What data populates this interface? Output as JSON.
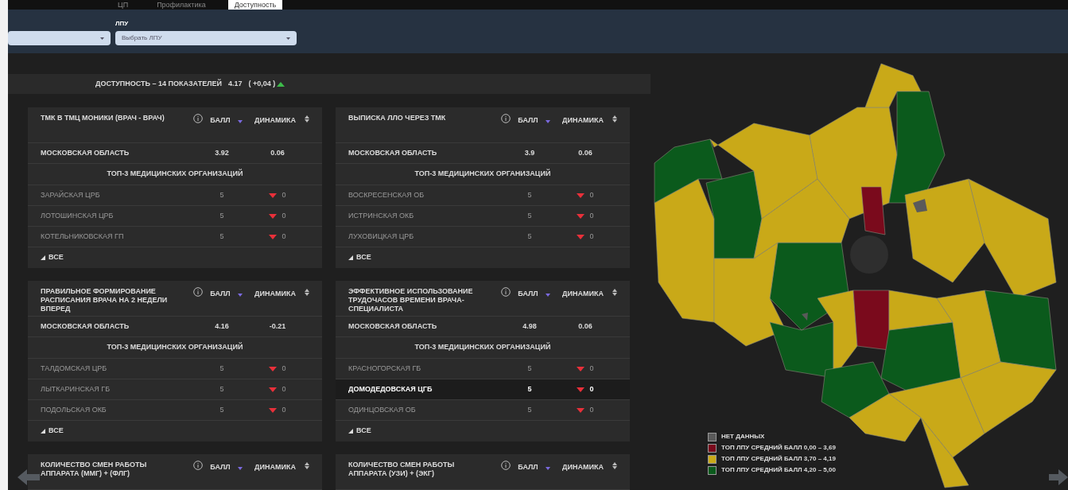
{
  "tabs": [
    {
      "label": "ЦП",
      "selected": false
    },
    {
      "label": "Профилактика",
      "selected": false
    },
    {
      "label": "Доступность",
      "selected": true
    }
  ],
  "filters": [
    {
      "kind": "dropdown"
    },
    {
      "kind": "dropdown",
      "label": "ЛПУ",
      "placeholder": "Выбрать ЛПУ"
    }
  ],
  "summary": {
    "title": "ДОСТУПНОСТЬ – 14 ПОКАЗАТЕЛЕЙ",
    "score": "4.17",
    "delta": "( +0,04 )",
    "rising": true
  },
  "cards": [
    {
      "title": "ТМК В ТМЦ МОНИКИ (ВРАЧ - ВРАЧ)",
      "score_header": "БАЛЛ",
      "dynamics_header": "ДИНАМИКА",
      "region": {
        "name": "МОСКОВСКАЯ ОБЛАСТЬ",
        "score": "3.92",
        "dynamics": "0.06"
      },
      "top_header": "ТОП-3 МЕДИЦИНСКИХ ОРГАНИЗАЦИЙ",
      "rows": [
        {
          "name": "ЗАРАЙСКАЯ ЦРБ",
          "score": "5",
          "dynamics": "0",
          "falling": true,
          "highlighted": false
        },
        {
          "name": "ЛОТОШИНСКАЯ ЦРБ",
          "score": "5",
          "dynamics": "0",
          "falling": true,
          "highlighted": false
        },
        {
          "name": "КОТЕЛЬНИКОВСКАЯ ГП",
          "score": "5",
          "dynamics": "0",
          "falling": true,
          "highlighted": false
        }
      ],
      "all_label": "ВСЕ"
    },
    {
      "title": "ВЫПИСКА ЛЛО ЧЕРЕЗ ТМК",
      "score_header": "БАЛЛ",
      "dynamics_header": "ДИНАМИКА",
      "region": {
        "name": "МОСКОВСКАЯ ОБЛАСТЬ",
        "score": "3.9",
        "dynamics": "0.06"
      },
      "top_header": "ТОП-3 МЕДИЦИНСКИХ ОРГАНИЗАЦИЙ",
      "rows": [
        {
          "name": "ВОСКРЕСЕНСКАЯ ОБ",
          "score": "5",
          "dynamics": "0",
          "falling": true,
          "highlighted": false
        },
        {
          "name": "ИСТРИНСКАЯ ОКБ",
          "score": "5",
          "dynamics": "0",
          "falling": true,
          "highlighted": false
        },
        {
          "name": "ЛУХОВИЦКАЯ ЦРБ",
          "score": "5",
          "dynamics": "0",
          "falling": true,
          "highlighted": false
        }
      ],
      "all_label": "ВСЕ"
    },
    {
      "title": "ПРАВИЛЬНОЕ ФОРМИРОВАНИЕ РАСПИСАНИЯ ВРАЧА НА 2 НЕДЕЛИ ВПЕРЕД",
      "score_header": "БАЛЛ",
      "dynamics_header": "ДИНАМИКА",
      "region": {
        "name": "МОСКОВСКАЯ ОБЛАСТЬ",
        "score": "4.16",
        "dynamics": "-0.21"
      },
      "top_header": "ТОП-3 МЕДИЦИНСКИХ ОРГАНИЗАЦИЙ",
      "rows": [
        {
          "name": "ТАЛДОМСКАЯ ЦРБ",
          "score": "5",
          "dynamics": "0",
          "falling": true,
          "highlighted": false
        },
        {
          "name": "ЛЫТКАРИНСКАЯ ГБ",
          "score": "5",
          "dynamics": "0",
          "falling": true,
          "highlighted": false
        },
        {
          "name": "ПОДОЛЬСКАЯ ОКБ",
          "score": "5",
          "dynamics": "0",
          "falling": true,
          "highlighted": false
        }
      ],
      "all_label": "ВСЕ"
    },
    {
      "title": "ЭФФЕКТИВНОЕ ИСПОЛЬЗОВАНИЕ ТРУДОЧАСОВ ВРЕМЕНИ ВРАЧА-СПЕЦИАЛИСТА",
      "score_header": "БАЛЛ",
      "dynamics_header": "ДИНАМИКА",
      "region": {
        "name": "МОСКОВСКАЯ ОБЛАСТЬ",
        "score": "4.98",
        "dynamics": "0.06"
      },
      "top_header": "ТОП-3 МЕДИЦИНСКИХ ОРГАНИЗАЦИЙ",
      "rows": [
        {
          "name": "КРАСНОГОРСКАЯ ГБ",
          "score": "5",
          "dynamics": "0",
          "falling": true,
          "highlighted": false
        },
        {
          "name": "ДОМОДЕДОВСКАЯ ЦГБ",
          "score": "5",
          "dynamics": "0",
          "falling": true,
          "highlighted": true
        },
        {
          "name": "ОДИНЦОВСКАЯ ОБ",
          "score": "5",
          "dynamics": "0",
          "falling": true,
          "highlighted": false
        }
      ],
      "all_label": "ВСЕ"
    },
    {
      "title": "КОЛИЧЕСТВО СМЕН РАБОТЫ АППАРАТА (ММГ) + (ФЛГ)",
      "score_header": "БАЛЛ",
      "dynamics_header": "ДИНАМИКА"
    },
    {
      "title": "КОЛИЧЕСТВО СМЕН РАБОТЫ АППАРАТА (УЗИ) + (ЭКГ)",
      "score_header": "БАЛЛ",
      "dynamics_header": "ДИНАМИКА"
    }
  ],
  "legend": [
    {
      "label": "НЕТ ДАННЫХ",
      "color": "#5a5a5a"
    },
    {
      "label": "ТОП ЛПУ СРЕДНИЙ БАЛЛ 0,00 – 3,69",
      "color": "#7a0a1c"
    },
    {
      "label": "ТОП ЛПУ СРЕДНИЙ БАЛЛ 3,70 – 4,19",
      "color": "#c9a918"
    },
    {
      "label": "ТОП ЛПУ СРЕДНИЙ БАЛЛ 4,20 – 5,00",
      "color": "#0b5a1c"
    }
  ]
}
